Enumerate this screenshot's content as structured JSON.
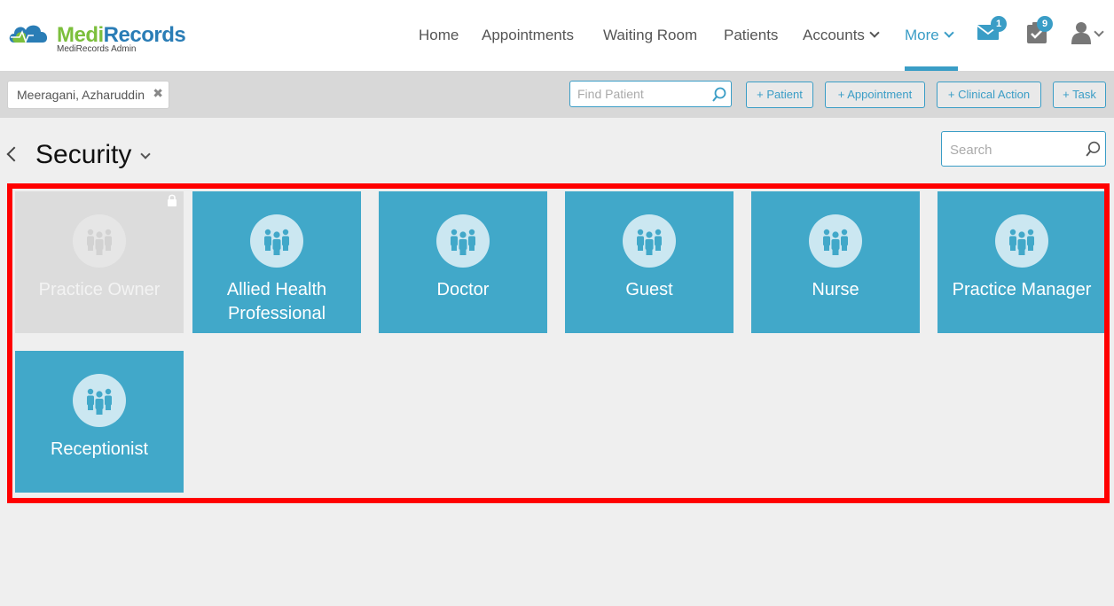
{
  "app": {
    "brand_part1": "Medi",
    "brand_part2": "Records",
    "brand_sub": "MediRecords Admin",
    "colors": {
      "accent": "#3a9dc6",
      "tile": "#41a8c9",
      "brand_green": "#7cbf3c",
      "brand_blue": "#2a7db6",
      "highlight_border": "#ff0000"
    }
  },
  "nav": {
    "home": "Home",
    "appointments": "Appointments",
    "waiting_room": "Waiting Room",
    "patients": "Patients",
    "accounts": "Accounts",
    "more": "More",
    "active": "More"
  },
  "header_icons": {
    "messages": {
      "icon": "envelope-icon",
      "count": "1"
    },
    "tasks": {
      "icon": "clipboard-check-icon",
      "count": "9"
    },
    "user": {
      "icon": "user-icon"
    }
  },
  "patient_bar": {
    "current_patient": "Meeragani, Azharuddin",
    "find_placeholder": "Find Patient",
    "buttons": [
      "+ Patient",
      "+ Appointment",
      "+ Clinical Action",
      "+ Task"
    ]
  },
  "page": {
    "title": "Security",
    "search_placeholder": "Search"
  },
  "roles": [
    {
      "label": "Practice Owner",
      "locked": true
    },
    {
      "label": "Allied Health Professional",
      "locked": false
    },
    {
      "label": "Doctor",
      "locked": false
    },
    {
      "label": "Guest",
      "locked": false
    },
    {
      "label": "Nurse",
      "locked": false
    },
    {
      "label": "Practice Manager",
      "locked": false
    },
    {
      "label": "Receptionist",
      "locked": false
    }
  ]
}
